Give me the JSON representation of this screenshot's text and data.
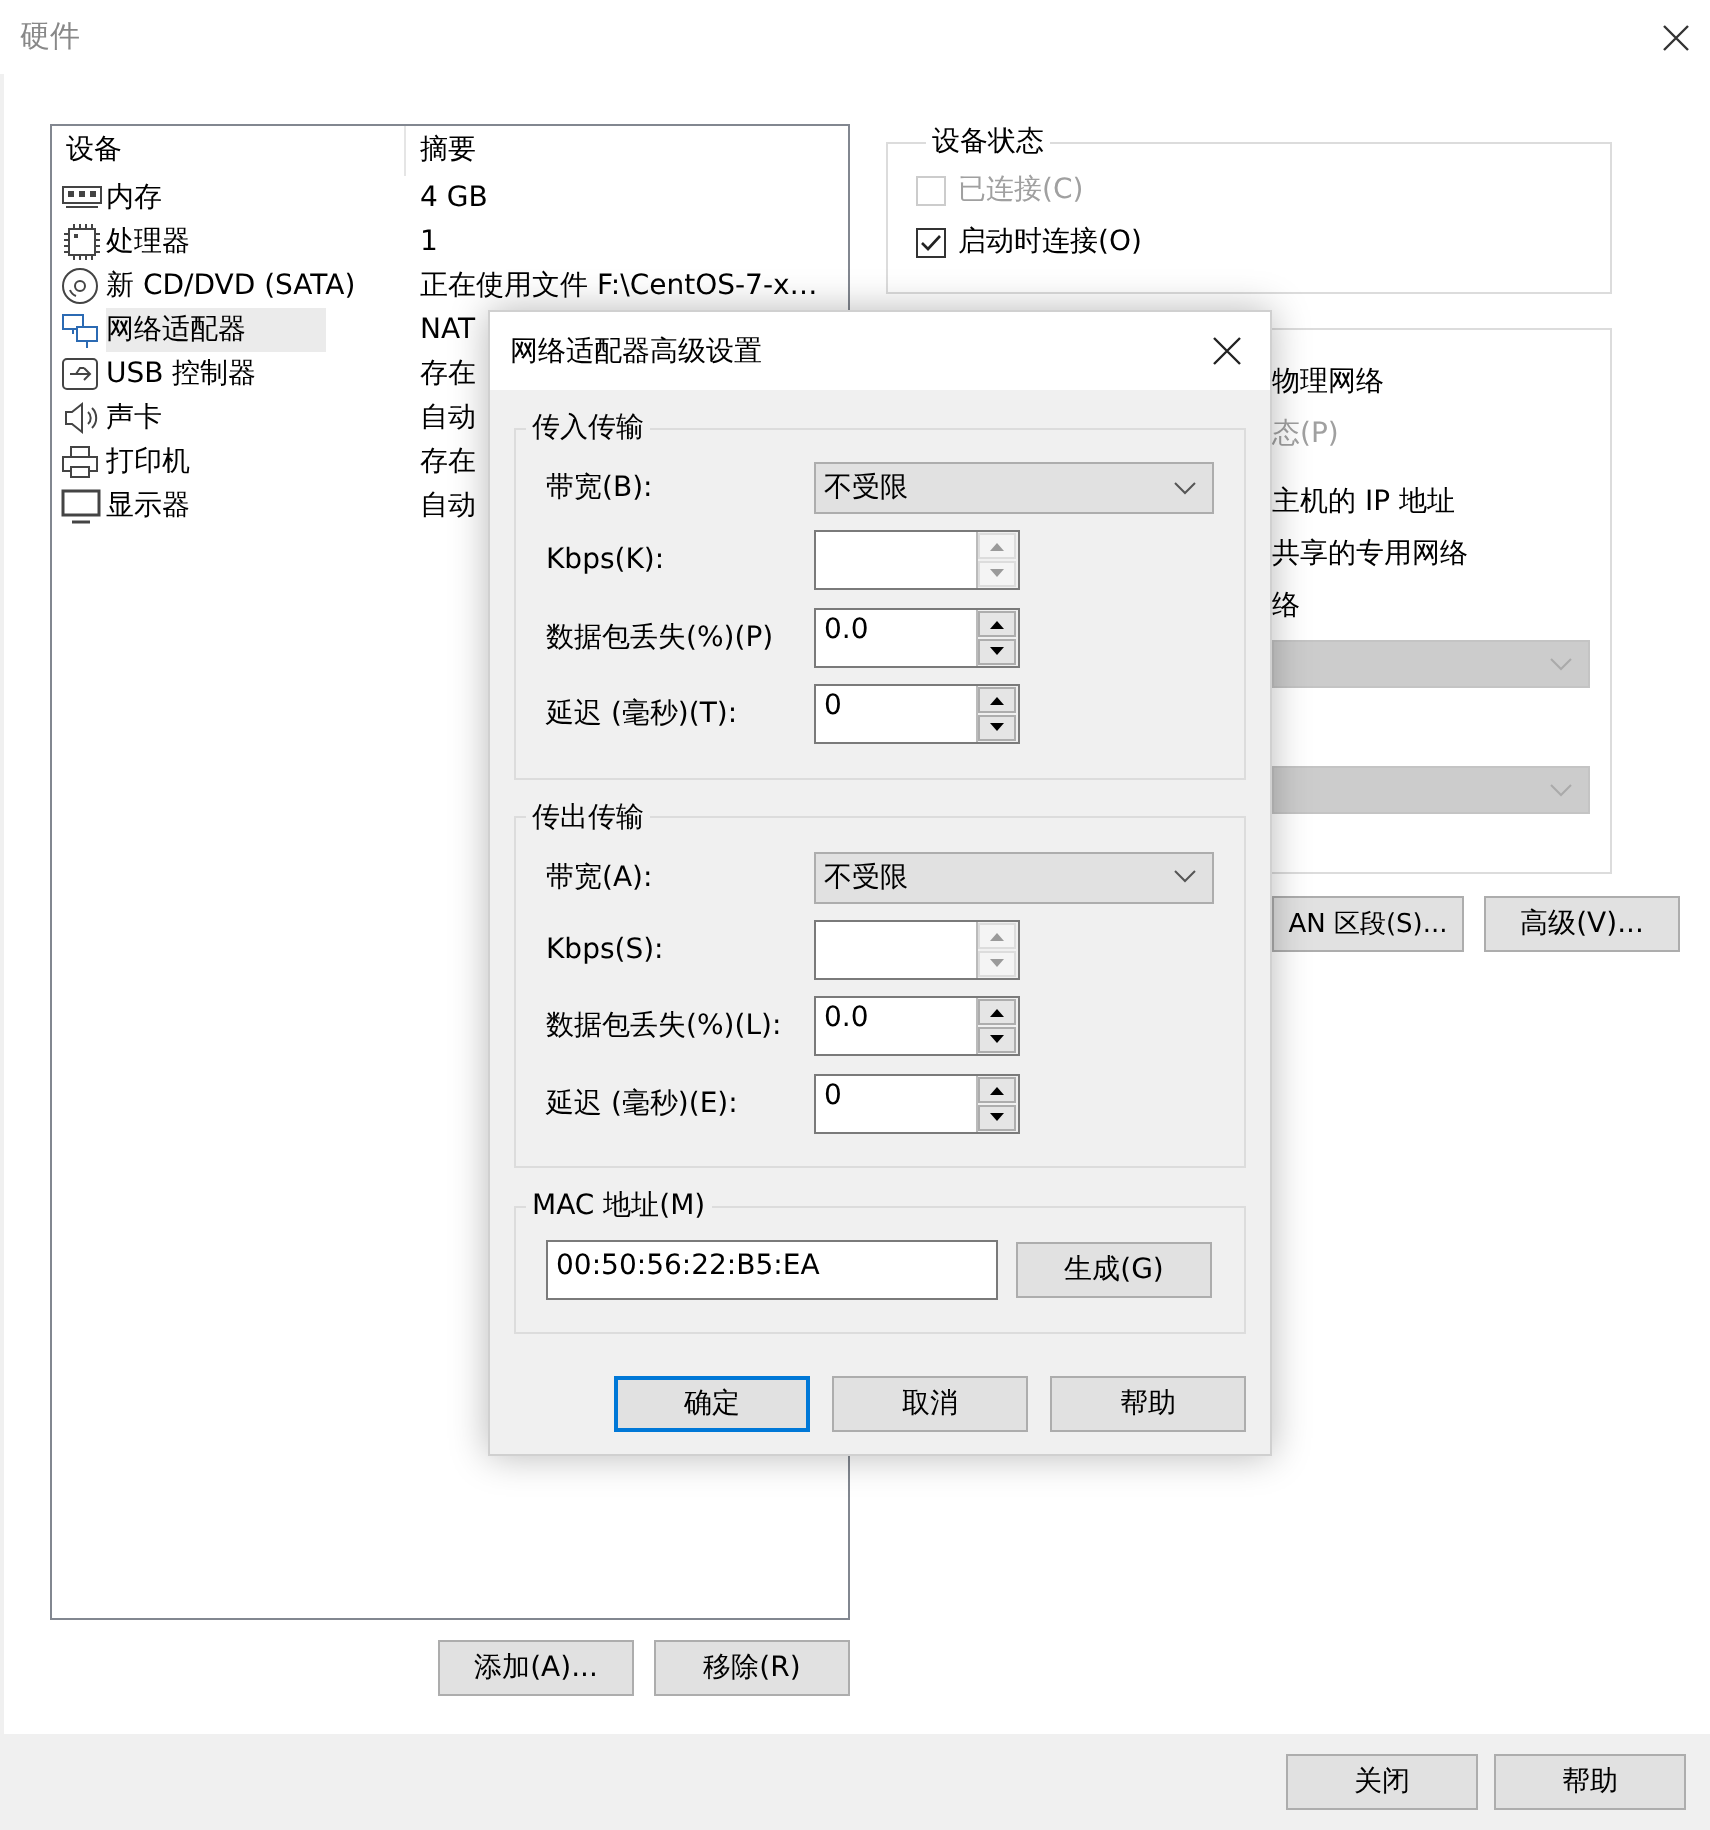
{
  "window": {
    "title": "硬件"
  },
  "device_table": {
    "columns": [
      "设备",
      "摘要"
    ],
    "rows": [
      {
        "device": "内存",
        "summary": "4 GB",
        "selected": false
      },
      {
        "device": "处理器",
        "summary": "1",
        "selected": false
      },
      {
        "device": "新 CD/DVD (SATA)",
        "summary": "正在使用文件 F:\\CentOS-7-x…",
        "selected": false
      },
      {
        "device": "网络适配器",
        "summary": "NAT",
        "selected": true
      },
      {
        "device": "USB 控制器",
        "summary": "存在",
        "selected": false
      },
      {
        "device": "声卡",
        "summary": "自动",
        "selected": false
      },
      {
        "device": "打印机",
        "summary": "存在",
        "selected": false
      },
      {
        "device": "显示器",
        "summary": "自动",
        "selected": false
      }
    ]
  },
  "list_buttons": [
    "添加(A)...",
    "移除(R)"
  ],
  "device_status": {
    "title": "设备状态",
    "options": [
      {
        "label": "已连接(C)",
        "checked": false,
        "disabled": true
      },
      {
        "label": "启动时连接(O)",
        "checked": true,
        "disabled": false
      }
    ]
  },
  "network_connection": {
    "fragments": [
      {
        "text": "物理网络",
        "disabled": false
      },
      {
        "text": "态(P)",
        "disabled": true
      },
      {
        "text": "主机的 IP 地址",
        "disabled": false
      },
      {
        "text": "共享的专用网络",
        "disabled": false
      },
      {
        "text": "络",
        "disabled": false
      }
    ],
    "dropdowns": [
      {
        "disabled": true
      },
      {
        "disabled": true
      }
    ],
    "buttons": [
      "AN 区段(S)...",
      "高级(V)..."
    ]
  },
  "dialog": {
    "title": "网络适配器高级设置",
    "groups": [
      {
        "title": "传入传输",
        "fields": [
          {
            "kind": "combo",
            "label": "带宽(B):",
            "value": "不受限"
          },
          {
            "kind": "spin",
            "label": "Kbps(K):",
            "disabled": true
          },
          {
            "kind": "spin",
            "label": "数据包丢失(%)(P)",
            "value": "0.0",
            "disabled": false
          },
          {
            "kind": "spin",
            "label": "延迟 (毫秒)(T):",
            "value": "0",
            "disabled": false
          }
        ]
      },
      {
        "title": "传出传输",
        "fields": [
          {
            "kind": "combo",
            "label": "带宽(A):",
            "value": "不受限"
          },
          {
            "kind": "spin",
            "label": "Kbps(S):",
            "disabled": true
          },
          {
            "kind": "spin",
            "label": "数据包丢失(%)(L):",
            "value": "0.0",
            "disabled": false
          },
          {
            "kind": "spin",
            "label": "延迟 (毫秒)(E):",
            "value": "0",
            "disabled": false
          }
        ]
      }
    ],
    "mac": {
      "title": "MAC 地址(M)",
      "value": "00:50:56:22:B5:EA",
      "button": "生成(G)"
    },
    "buttons": [
      {
        "label": "确定",
        "default": true
      },
      {
        "label": "取消",
        "default": false
      },
      {
        "label": "帮助",
        "default": false
      }
    ]
  },
  "footer_buttons": [
    "关闭",
    "帮助"
  ]
}
